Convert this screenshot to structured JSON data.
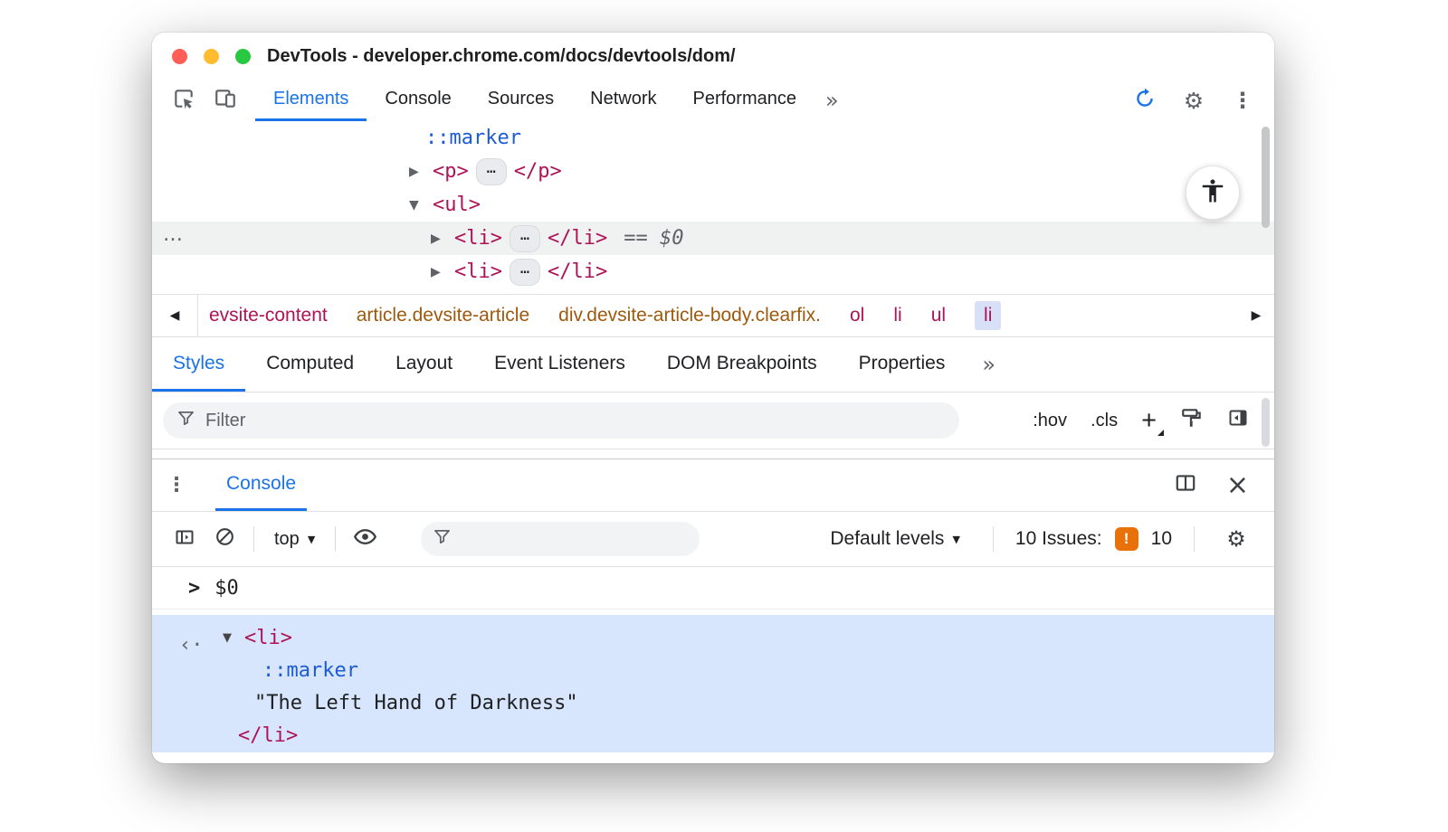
{
  "window": {
    "title": "DevTools - developer.chrome.com/docs/devtools/dom/"
  },
  "colors": {
    "accent_blue": "#1a73e8",
    "tag_pink": "#ad1457",
    "class_orange": "#9d5a0e",
    "pseudo_blue": "#1d5bd6",
    "issues_orange": "#e8710a",
    "result_selection_bg": "#d8e6fd",
    "selected_row_bg": "#f0f1f1"
  },
  "icons": {
    "collapsed": "▶",
    "expanded": "▼",
    "caret_down": "▼",
    "prev": "◀",
    "next": "▶",
    "kebab": "⋮",
    "gear": "⚙",
    "close": "×",
    "more": "»",
    "ellipsis": "…",
    "left_dots": "…",
    "output_arrow": "‹·",
    "prompt_chevron": ">"
  },
  "main_tabs": {
    "items": [
      "Elements",
      "Console",
      "Sources",
      "Network",
      "Performance"
    ]
  },
  "elements_panel": {
    "rows": {
      "marker": "::marker",
      "p_open": "<p>",
      "p_close": "</p>",
      "ul_open": "<ul>",
      "li_open": "<li>",
      "li_close": "</li>",
      "selected_suffix": "== $0"
    }
  },
  "breadcrumb": {
    "items": [
      "evsite-content",
      "article.devsite-article",
      "div.devsite-article-body.clearfix.",
      "ol",
      "li",
      "ul",
      "li"
    ]
  },
  "styles_tabs": {
    "items": [
      "Styles",
      "Computed",
      "Layout",
      "Event Listeners",
      "DOM Breakpoints",
      "Properties"
    ]
  },
  "styles_toolbar": {
    "filter_placeholder": "Filter",
    "hov": ":hov",
    "cls": ".cls",
    "plus": "+"
  },
  "console": {
    "tab": "Console",
    "context": "top",
    "levels": "Default levels",
    "issues_label": "10 Issues:",
    "issues_mark": "!",
    "issues_count": "10",
    "prompt_value": "$0",
    "result": {
      "li_open": "<li>",
      "marker": "::marker",
      "text": "\"The Left Hand of Darkness\"",
      "li_close": "</li>"
    }
  }
}
